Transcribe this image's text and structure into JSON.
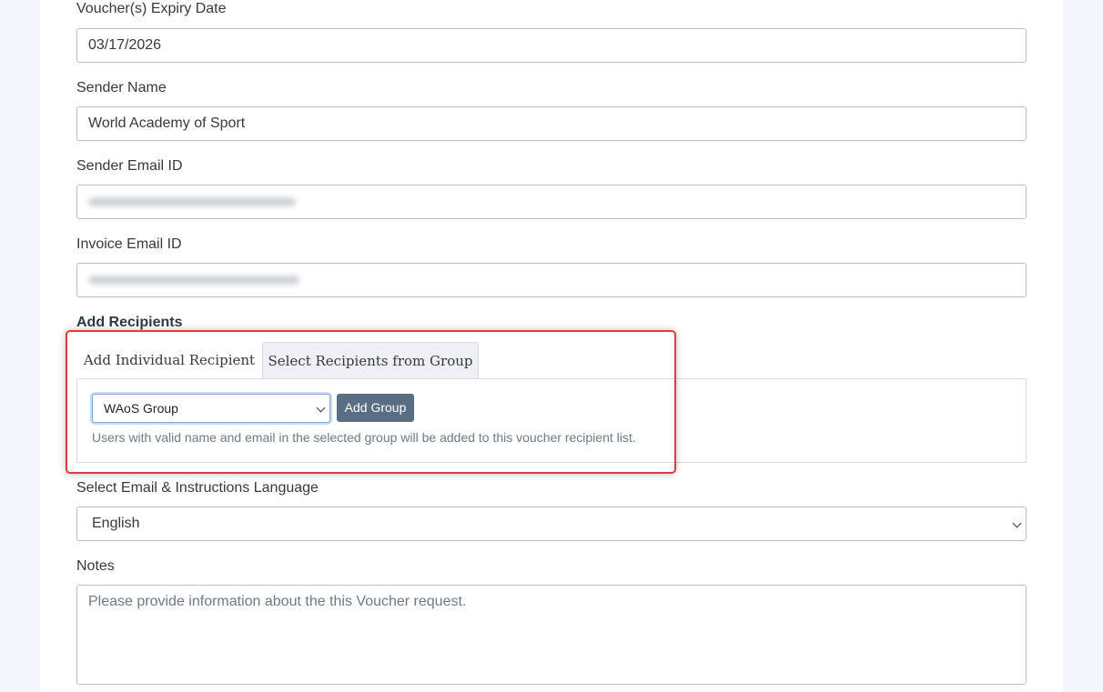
{
  "form": {
    "expiry": {
      "label": "Voucher(s) Expiry Date",
      "value": "03/17/2026"
    },
    "sender_name": {
      "label": "Sender Name",
      "value": "World Academy of Sport"
    },
    "sender_email": {
      "label": "Sender Email ID",
      "value": "[redacted]"
    },
    "invoice_email": {
      "label": "Invoice Email ID",
      "value": "[redacted]"
    },
    "recipients": {
      "heading": "Add Recipients",
      "tabs": [
        {
          "label": "Add Individual Recipient",
          "active": false
        },
        {
          "label": "Select Recipients from Group",
          "active": true
        }
      ],
      "group_select": {
        "value": "WAoS Group"
      },
      "add_group_label": "Add Group",
      "help_text": "Users with valid name and email in the selected group will be added to this voucher recipient list."
    },
    "language": {
      "label": "Select Email & Instructions Language",
      "value": "English"
    },
    "notes": {
      "label": "Notes",
      "placeholder": "Please provide information about the this Voucher request."
    }
  },
  "highlight_color": "#e33a3a",
  "button_color": "#5b6d82"
}
